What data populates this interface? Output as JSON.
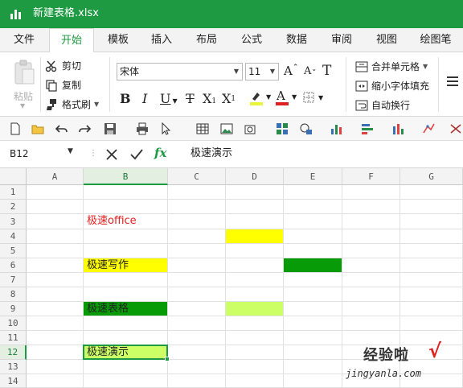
{
  "window": {
    "title": "新建表格.xlsx",
    "title_bar_color": "#1e9a42"
  },
  "menu": {
    "tabs": [
      {
        "label": "文件"
      },
      {
        "label": "开始"
      },
      {
        "label": "模板"
      },
      {
        "label": "插入"
      },
      {
        "label": "布局"
      },
      {
        "label": "公式"
      },
      {
        "label": "数据"
      },
      {
        "label": "审阅"
      },
      {
        "label": "视图"
      },
      {
        "label": "绘图笔"
      }
    ],
    "active_index": 1
  },
  "ribbon": {
    "paste_label": "粘贴",
    "cut_label": "剪切",
    "copy_label": "复制",
    "format_painter_label": "格式刷",
    "font_name": "宋体",
    "font_size": "11",
    "merge_label": "合并单元格",
    "shrink_label": "缩小字体填充",
    "wrap_label": "自动换行",
    "format_buttons": [
      "B",
      "I",
      "U",
      "T",
      "X",
      "X"
    ],
    "highlight_color": "#e8f53a",
    "font_color": "#e02020"
  },
  "formula_bar": {
    "name_box": "B12",
    "fx_label": "fx",
    "formula": "极速演示"
  },
  "grid": {
    "columns": [
      "A",
      "B",
      "C",
      "D",
      "E",
      "F",
      "G"
    ],
    "selected_column": "B",
    "rows": [
      "1",
      "2",
      "3",
      "4",
      "5",
      "6",
      "7",
      "8",
      "9",
      "10",
      "11",
      "12",
      "13",
      "14"
    ],
    "selected_row": "12",
    "cells": [
      {
        "ref": "B3",
        "text": "极速office",
        "color": "#e02020"
      },
      {
        "ref": "B6",
        "text": "极速写作",
        "fill": "#ffff00"
      },
      {
        "ref": "B9",
        "text": "极速表格",
        "fill": "#079b07"
      },
      {
        "ref": "B12",
        "text": "极速演示",
        "fill": "#ccff66"
      }
    ],
    "fills": [
      {
        "ref": "D4",
        "color": "#ffff00"
      },
      {
        "ref": "E6",
        "color": "#079b07"
      },
      {
        "ref": "D9",
        "color": "#ccff66"
      }
    ]
  },
  "watermark": {
    "text": "经验啦",
    "url": "jingyanla.com"
  }
}
